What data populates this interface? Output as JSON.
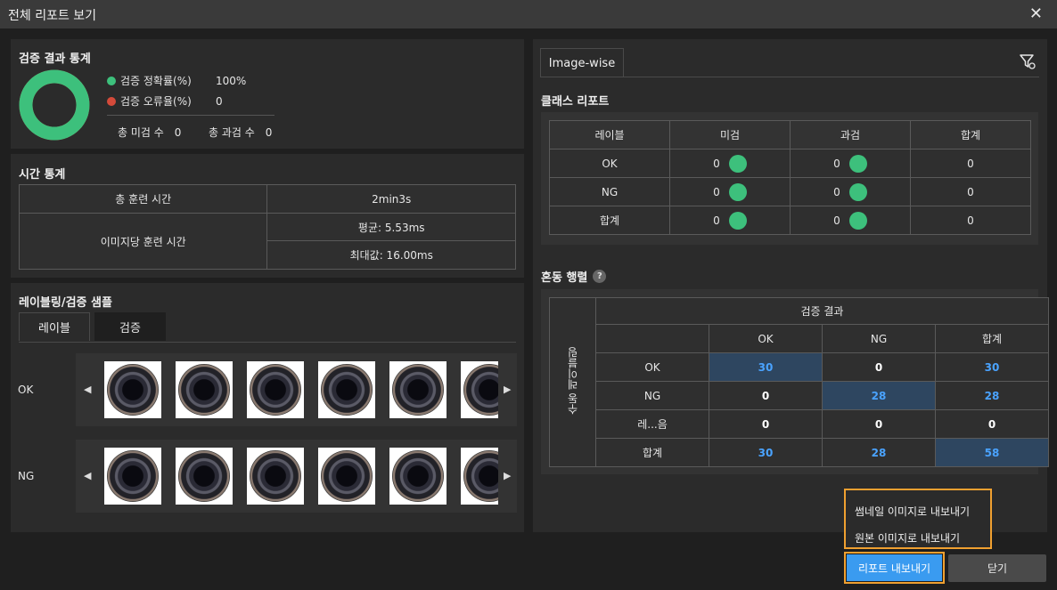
{
  "window": {
    "title": "전체 리포트 보기",
    "close_glyph": "✕"
  },
  "stats": {
    "title": "검증 결과 통계",
    "accuracy_label": "검증 정확률(%)",
    "accuracy_value": "100%",
    "error_label": "검증 오류율(%)",
    "error_value": "0",
    "missed_label": "총 미검 수",
    "missed_value": "0",
    "overkill_label": "총 과검 수",
    "overkill_value": "0",
    "accuracy_fraction": 1.0,
    "colors": {
      "accuracy": "#3dc07c",
      "error": "#d44a3a"
    }
  },
  "time": {
    "title": "시간 통계",
    "total_label": "총 훈련 시간",
    "total_value": "2min3s",
    "per_image_label": "이미지당 훈련 시간",
    "avg_value": "평균: 5.53ms",
    "max_value": "최대값: 16.00ms"
  },
  "samples": {
    "title": "레이블링/검증 샘플",
    "tabs": [
      "레이블",
      "검증"
    ],
    "rows": [
      {
        "label": "OK",
        "count": 6
      },
      {
        "label": "NG",
        "count": 6
      }
    ],
    "left_arrow": "◀",
    "right_arrow": "▶"
  },
  "right": {
    "tab": "Image-wise",
    "filter_icon": "filter-settings-icon",
    "class_report": {
      "title": "클래스 리포트",
      "headers": [
        "레이블",
        "미검",
        "과검",
        "합계"
      ],
      "rows": [
        {
          "label": "OK",
          "missed": "0",
          "overkill": "0",
          "total": "0"
        },
        {
          "label": "NG",
          "missed": "0",
          "overkill": "0",
          "total": "0"
        },
        {
          "label": "합계",
          "missed": "0",
          "overkill": "0",
          "total": "0"
        }
      ]
    },
    "confusion": {
      "title": "혼동 행렬",
      "help": "?",
      "top_header": "검증 결과",
      "side_header": "수동 레이블링",
      "col_headers": [
        "OK",
        "NG",
        "합계"
      ],
      "rows": [
        {
          "label": "OK",
          "values": [
            "30",
            "0",
            "30"
          ]
        },
        {
          "label": "NG",
          "values": [
            "0",
            "28",
            "28"
          ]
        },
        {
          "label": "레...음",
          "values": [
            "0",
            "0",
            "0"
          ]
        },
        {
          "label": "합계",
          "values": [
            "30",
            "28",
            "58"
          ]
        }
      ]
    }
  },
  "export_menu": {
    "items": [
      "썸네일 이미지로 내보내기",
      "원본 이미지로 내보내기"
    ]
  },
  "buttons": {
    "export": "리포트 내보내기",
    "close": "닫기"
  }
}
